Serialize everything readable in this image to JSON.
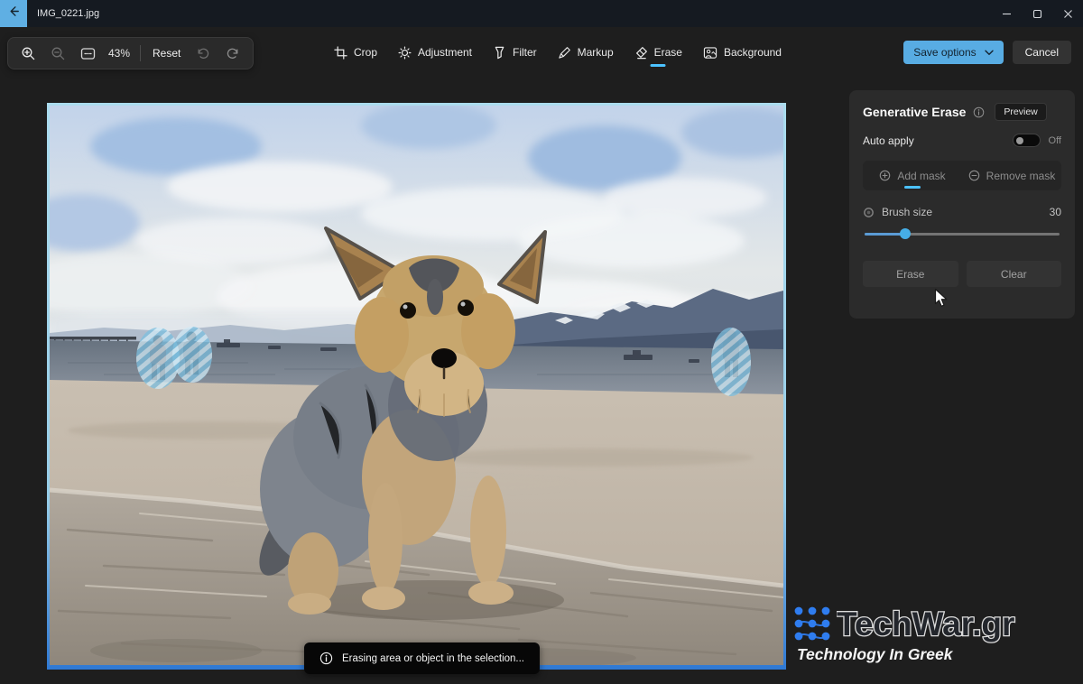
{
  "titlebar": {
    "title": "IMG_0221.jpg"
  },
  "toolbar": {
    "zoom_percent": "43%",
    "reset": "Reset",
    "tabs": [
      {
        "label": "Crop"
      },
      {
        "label": "Adjustment"
      },
      {
        "label": "Filter"
      },
      {
        "label": "Markup"
      },
      {
        "label": "Erase",
        "active": true
      },
      {
        "label": "Background"
      }
    ],
    "save_options": "Save options",
    "cancel": "Cancel"
  },
  "panel": {
    "title": "Generative Erase",
    "preview_badge": "Preview",
    "auto_apply_label": "Auto apply",
    "auto_apply_state": "Off",
    "mask_tabs": [
      {
        "label": "Add mask",
        "active": true
      },
      {
        "label": "Remove mask"
      }
    ],
    "brush_size_label": "Brush size",
    "brush_size_value": "30",
    "erase_button": "Erase",
    "clear_button": "Clear"
  },
  "toast": {
    "message": "Erasing area or object in the selection..."
  },
  "watermark": {
    "brand": "TechWar.gr",
    "tagline": "Technology In Greek"
  },
  "colors": {
    "accent": "#4cc2ff",
    "save_button": "#58ace3",
    "selection_border_top": "#abdcee",
    "selection_border_bottom": "#2f79d4",
    "mask_stripe": "#7cbede"
  }
}
